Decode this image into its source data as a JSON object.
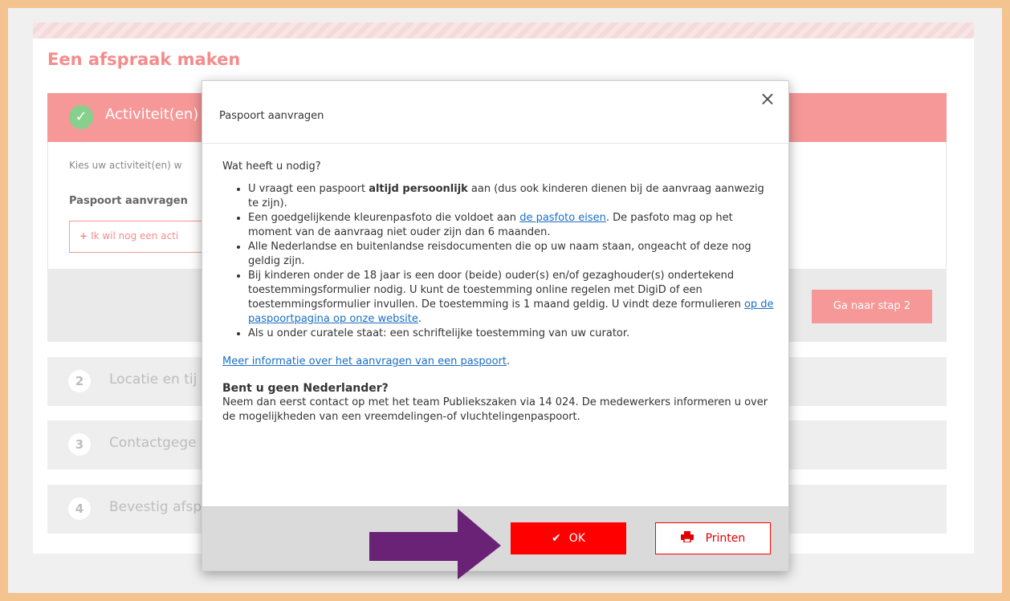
{
  "page": {
    "title": "Een afspraak maken",
    "step1": {
      "label": "Activiteit(en)",
      "hint": "Kies uw activiteit(en) w",
      "chosen": "Paspoort aanvragen",
      "add_button": "Ik wil nog een acti",
      "next_button": "Ga naar stap 2"
    },
    "steps": [
      {
        "num": "2",
        "label": "Locatie en tij"
      },
      {
        "num": "3",
        "label": "Contactgege"
      },
      {
        "num": "4",
        "label": "Bevestig afsp"
      }
    ]
  },
  "modal": {
    "title": "Paspoort aanvragen",
    "close_glyph": "×",
    "intro": "Wat heeft u nodig?",
    "bullets": {
      "b1_pre": "U vraagt een paspoort ",
      "b1_bold": "altijd persoonlijk",
      "b1_post": " aan (dus ook kinderen dienen bij de aanvraag aanwezig te zijn).",
      "b2_pre": "Een goedgelijkende kleurenpasfoto die voldoet aan ",
      "b2_link": "de pasfoto eisen",
      "b2_post": ". De pasfoto mag op het moment van de aanvraag niet ouder zijn dan 6 maanden.",
      "b3": "Alle Nederlandse en buitenlandse reisdocumenten die op uw naam staan, ongeacht of deze nog geldig zijn.",
      "b4_pre": "Bij kinderen onder de 18 jaar is een door (beide) ouder(s) en/of gezaghouder(s) ondertekend toestemmingsformulier nodig. U kunt de toestemming online regelen met DigiD of een toestemmingsformulier invullen. De toestemming is 1 maand geldig. U vindt deze formulieren ",
      "b4_link": "op de paspoortpagina op onze website",
      "b4_post": ".",
      "b5": "Als u onder curatele staat: een schriftelijke toestemming van uw curator."
    },
    "more_link": "Meer informatie over het aanvragen van een paspoort",
    "more_post": ".",
    "foreign_title": "Bent u geen Nederlander?",
    "foreign_text": "Neem dan eerst contact op met het team Publiekszaken via 14 024. De medewerkers informeren u over de mogelijkheden van een vreemdelingen-of vluchtelingenpaspoort.",
    "ok_label": "OK",
    "print_label": "Printen"
  },
  "colors": {
    "accent": "#f79898",
    "primary_button": "#ff0000",
    "arrow": "#6a2277",
    "border": "#f3c48f"
  },
  "icons": [
    "check-icon",
    "plus-icon",
    "close-icon",
    "checkmark-icon",
    "printer-icon",
    "arrow-icon"
  ]
}
